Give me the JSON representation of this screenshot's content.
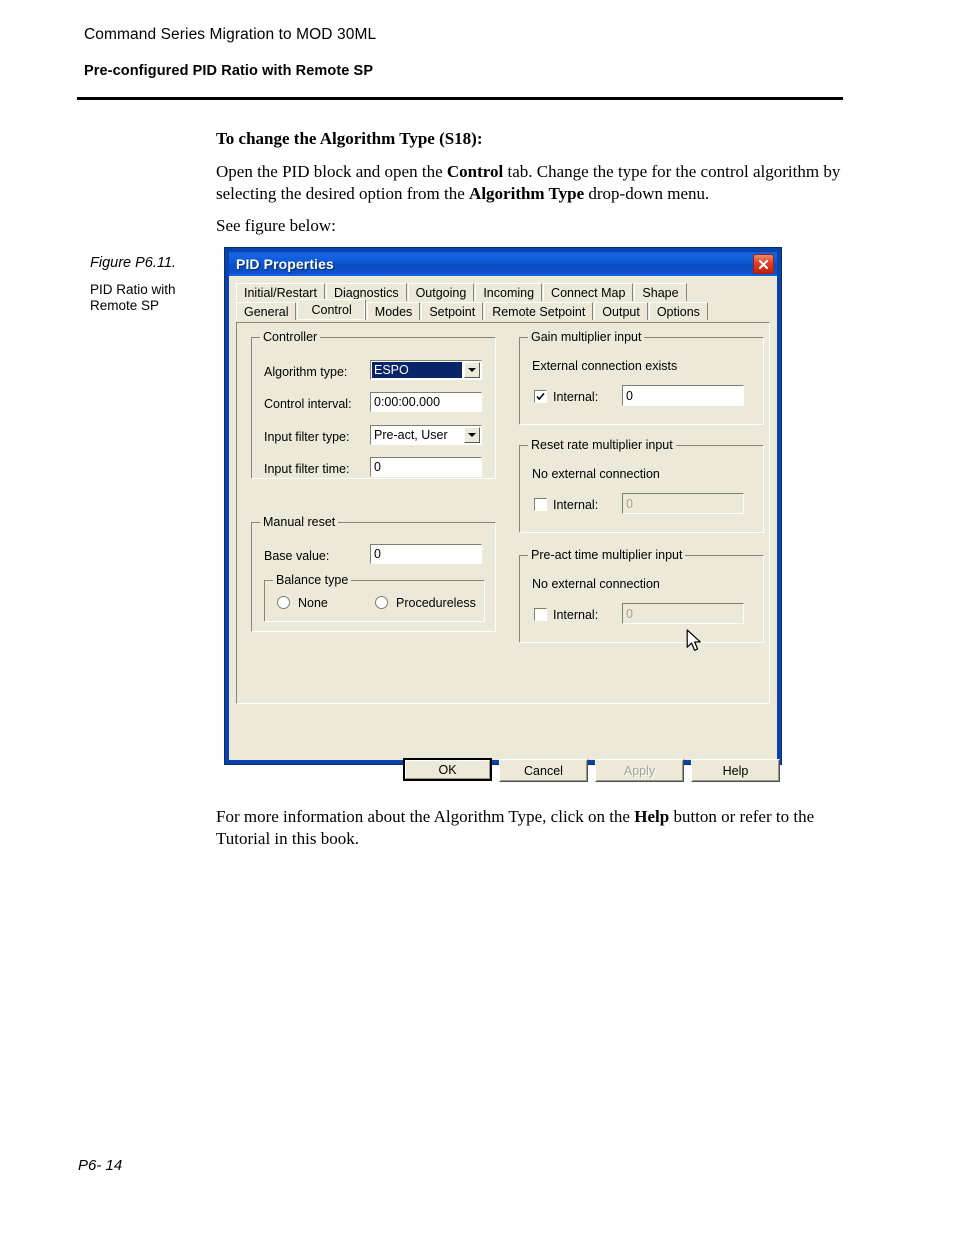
{
  "page": {
    "header_line1": "Command Series Migration to MOD 30ML",
    "header_line2": "Pre-configured PID Ratio with Remote SP",
    "heading": "To change the Algorithm Type (S18):",
    "para1_a": "Open the PID block and open the ",
    "para1_b": "Control",
    "para1_c": " tab. Change the type for the control algorithm by selecting the desired option from the ",
    "para1_d": "Algorithm Type",
    "para1_e": " drop-down menu.",
    "para2": "See figure below:",
    "para3_a": "For more information about the Algorithm Type, click on the ",
    "para3_b": "Help",
    "para3_c": " button or refer to the Tutorial in this book.",
    "footer": "P6- 14"
  },
  "figure": {
    "caption_title": "Figure P6.11.",
    "caption_body": "PID Ratio with Remote SP"
  },
  "dialog": {
    "title": "PID Properties",
    "close_icon": "close-icon",
    "tabs_row1": [
      {
        "label": "Initial/Restart",
        "selected": false
      },
      {
        "label": "Diagnostics",
        "selected": false
      },
      {
        "label": "Outgoing",
        "selected": false
      },
      {
        "label": "Incoming",
        "selected": false
      },
      {
        "label": "Connect Map",
        "selected": false
      },
      {
        "label": "Shape",
        "selected": false
      }
    ],
    "tabs_row2": [
      {
        "label": "General",
        "selected": false
      },
      {
        "label": "Control",
        "selected": true
      },
      {
        "label": "Modes",
        "selected": false
      },
      {
        "label": "Setpoint",
        "selected": false
      },
      {
        "label": "Remote Setpoint",
        "selected": false
      },
      {
        "label": "Output",
        "selected": false
      },
      {
        "label": "Options",
        "selected": false
      }
    ],
    "controller": {
      "title": "Controller",
      "algorithm_type_label": "Algorithm type:",
      "algorithm_type_value": "ESPO",
      "control_interval_label": "Control interval:",
      "control_interval_value": "0:00:00.000",
      "input_filter_type_label": "Input filter type:",
      "input_filter_type_value": "Pre-act, User",
      "input_filter_time_label": "Input filter time:",
      "input_filter_time_value": "0"
    },
    "manual_reset": {
      "title": "Manual reset",
      "base_value_label": "Base value:",
      "base_value": "0",
      "balance_type": {
        "title": "Balance type",
        "option_none": "None",
        "option_procedureless": "Procedureless",
        "selected": "Procedureless"
      }
    },
    "gain_multiplier": {
      "title": "Gain multiplier input",
      "status": "External connection exists",
      "internal_label": "Internal:",
      "internal_checked": true,
      "internal_value": "0",
      "internal_enabled": true
    },
    "reset_rate_multiplier": {
      "title": "Reset rate multiplier input",
      "status": "No external connection",
      "internal_label": "Internal:",
      "internal_checked": false,
      "internal_value": "0",
      "internal_enabled": false
    },
    "preact_time_multiplier": {
      "title": "Pre-act time multiplier input",
      "status": "No external connection",
      "internal_label": "Internal:",
      "internal_checked": false,
      "internal_value": "0",
      "internal_enabled": false
    },
    "buttons": {
      "ok": "OK",
      "cancel": "Cancel",
      "apply": "Apply",
      "help": "Help"
    }
  },
  "colors": {
    "titlebar_blue": "#0a53cf",
    "frame_blue": "#0b41ab",
    "dialog_face": "#ece9d8",
    "selection_blue": "#0a246a",
    "close_red": "#c0210b",
    "disabled_text": "#a6a293"
  }
}
